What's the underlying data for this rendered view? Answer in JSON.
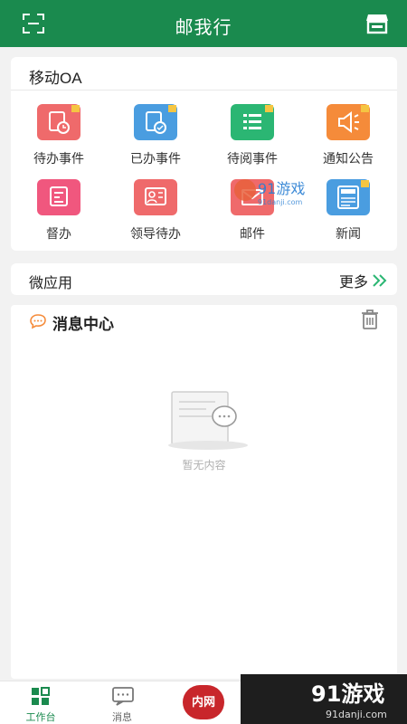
{
  "header": {
    "title": "邮我行",
    "scan_icon": "scan-icon",
    "store_icon": "store-icon",
    "bg_color": "#1a8a4e"
  },
  "oa": {
    "title": "移动OA",
    "items": [
      {
        "label": "待办事件",
        "icon": "pending-tasks-icon",
        "color": "#ef6a6b"
      },
      {
        "label": "已办事件",
        "icon": "done-tasks-icon",
        "color": "#4a9de0"
      },
      {
        "label": "待阅事件",
        "icon": "to-read-icon",
        "color": "#2bb673"
      },
      {
        "label": "通知公告",
        "icon": "announcement-icon",
        "color": "#f58b3a"
      },
      {
        "label": "督办",
        "icon": "supervise-icon",
        "color": "#f0577e"
      },
      {
        "label": "领导待办",
        "icon": "leader-tasks-icon",
        "color": "#ef6a6b"
      },
      {
        "label": "邮件",
        "icon": "mail-icon",
        "color": "#ef6a6b"
      },
      {
        "label": "新闻",
        "icon": "news-icon",
        "color": "#4a9de0"
      }
    ]
  },
  "micro_apps": {
    "title": "微应用",
    "more_label": "更多"
  },
  "messages": {
    "title": "消息中心",
    "empty_text": "暂无内容"
  },
  "tabbar": {
    "items": [
      {
        "label": "工作台",
        "icon": "workbench-icon",
        "active": true
      },
      {
        "label": "消息",
        "icon": "message-icon",
        "active": false
      }
    ],
    "intranet_label": "内网",
    "active_color": "#1a8a4e"
  },
  "watermark": {
    "brand": "91游戏",
    "domain": "91danji.com"
  }
}
